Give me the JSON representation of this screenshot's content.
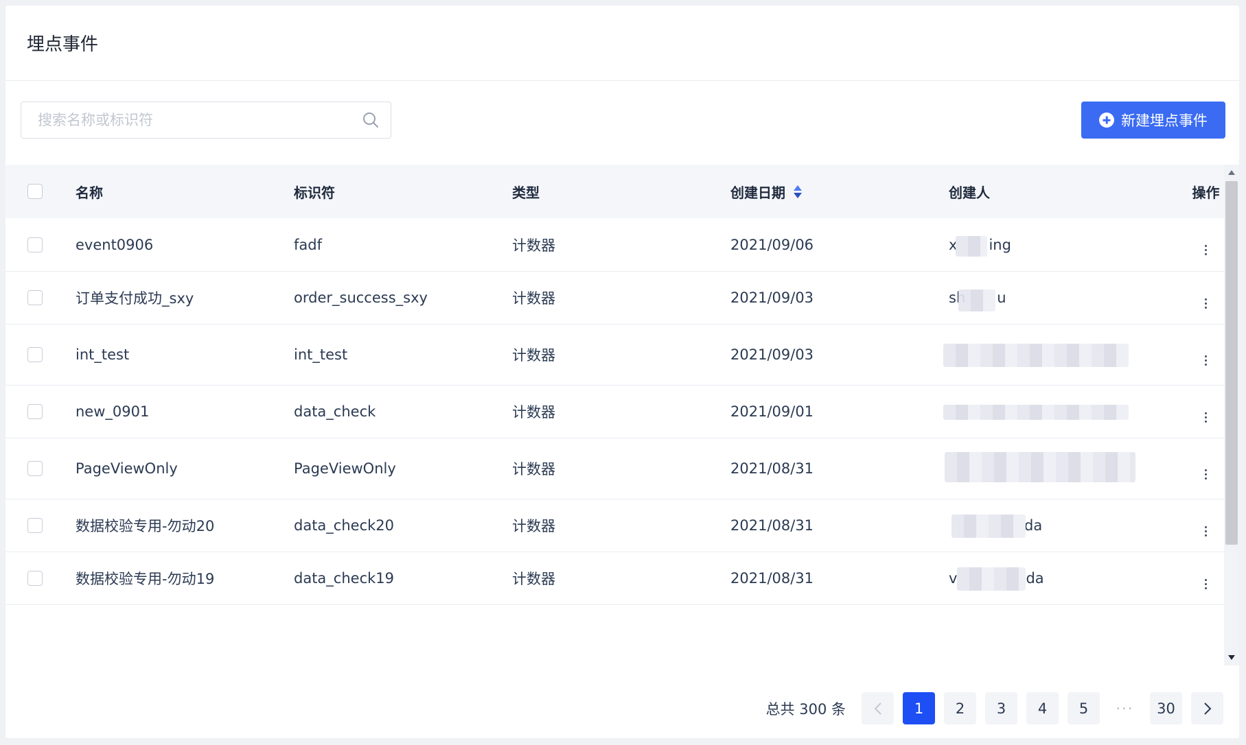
{
  "header": {
    "title": "埋点事件"
  },
  "search": {
    "placeholder": "搜索名称或标识符"
  },
  "create_button": {
    "label": "新建埋点事件"
  },
  "table": {
    "columns": [
      "名称",
      "标识符",
      "类型",
      "创建日期",
      "创建人",
      "操作"
    ],
    "rows": [
      {
        "name": "event0906",
        "identifier": "fadf",
        "type": "计数器",
        "date": "2021/09/06",
        "creator_visible": "x",
        "creator_suffix": "ing"
      },
      {
        "name": "订单支付成功_sxy",
        "identifier": "order_success_sxy",
        "type": "计数器",
        "date": "2021/09/03",
        "creator_visible": "sh",
        "creator_suffix": "u"
      },
      {
        "name": "int_test",
        "identifier": "int_test",
        "type": "计数器",
        "date": "2021/09/03",
        "creator_visible": "",
        "creator_suffix": ""
      },
      {
        "name": "new_0901",
        "identifier": "data_check",
        "type": "计数器",
        "date": "2021/09/01",
        "creator_visible": "",
        "creator_suffix": ""
      },
      {
        "name": "PageViewOnly",
        "identifier": "PageViewOnly",
        "type": "计数器",
        "date": "2021/08/31",
        "creator_visible": "",
        "creator_suffix": ""
      },
      {
        "name": "数据校验专用-勿动20",
        "identifier": "data_check20",
        "type": "计数器",
        "date": "2021/08/31",
        "creator_visible": "",
        "creator_suffix": "da"
      },
      {
        "name": "数据校验专用-勿动19",
        "identifier": "data_check19",
        "type": "计数器",
        "date": "2021/08/31",
        "creator_visible": "v",
        "creator_suffix": "da"
      }
    ]
  },
  "pagination": {
    "total_label": "总共 300 条",
    "pages": [
      "1",
      "2",
      "3",
      "4",
      "5"
    ],
    "ellipsis": "···",
    "last_page": "30",
    "current": 1,
    "prev_icon": "chevron-left-icon",
    "next_icon": "chevron-right-icon"
  },
  "colors": {
    "accent": "#1d4ff5",
    "button": "#3a6bf2"
  }
}
